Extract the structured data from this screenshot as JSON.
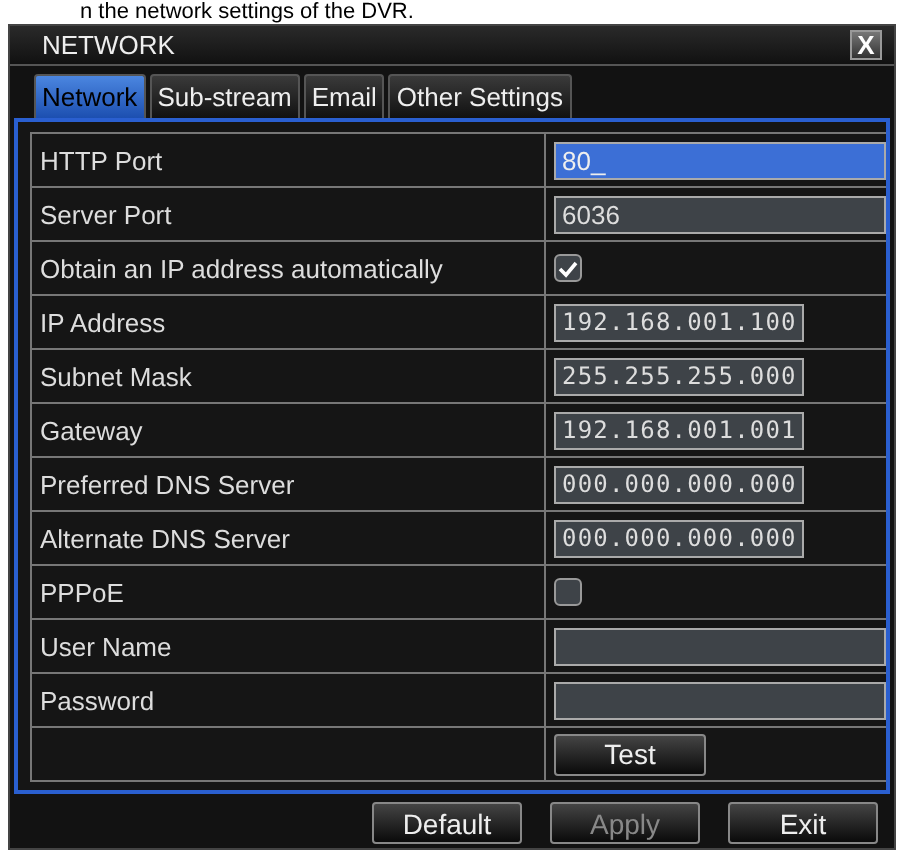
{
  "caption": "n the network settings of the DVR.",
  "window": {
    "title": "NETWORK",
    "close": "X"
  },
  "tabs": [
    {
      "label": "Network",
      "selected": true
    },
    {
      "label": "Sub-stream",
      "selected": false
    },
    {
      "label": "Email",
      "selected": false
    },
    {
      "label": "Other Settings",
      "selected": false
    }
  ],
  "rows": [
    {
      "label": "HTTP Port",
      "kind": "text",
      "value": "80_",
      "focused": true
    },
    {
      "label": "Server Port",
      "kind": "text",
      "value": "6036",
      "focused": false
    },
    {
      "label": "Obtain an IP address automatically",
      "kind": "checkbox",
      "checked": true
    },
    {
      "label": "IP Address",
      "kind": "ip",
      "value": "192.168.001.100"
    },
    {
      "label": "Subnet Mask",
      "kind": "ip",
      "value": "255.255.255.000"
    },
    {
      "label": "Gateway",
      "kind": "ip",
      "value": "192.168.001.001"
    },
    {
      "label": "Preferred DNS Server",
      "kind": "ip",
      "value": "000.000.000.000"
    },
    {
      "label": "Alternate DNS Server",
      "kind": "ip",
      "value": "000.000.000.000"
    },
    {
      "label": "PPPoE",
      "kind": "checkbox",
      "checked": false
    },
    {
      "label": "User Name",
      "kind": "text",
      "value": "",
      "focused": false
    },
    {
      "label": "Password",
      "kind": "text",
      "value": "",
      "focused": false
    },
    {
      "kind": "button",
      "button": "Test"
    }
  ],
  "buttons": [
    {
      "label": "Default",
      "disabled": false
    },
    {
      "label": "Apply",
      "disabled": true
    },
    {
      "label": "Exit",
      "disabled": false
    }
  ]
}
